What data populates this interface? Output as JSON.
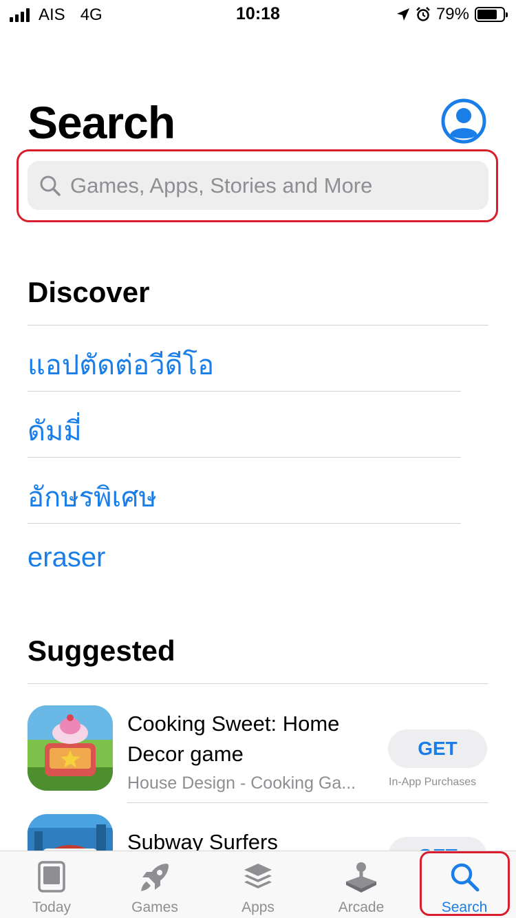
{
  "status_bar": {
    "carrier": "AIS",
    "network": "4G",
    "time": "10:18",
    "battery_percent": "79%",
    "battery_level": 0.79
  },
  "header": {
    "title": "Search",
    "account_icon": "person-circle-icon"
  },
  "search": {
    "placeholder": "Games, Apps, Stories and More",
    "value": ""
  },
  "discover": {
    "title": "Discover",
    "items": [
      "แอปตัดต่อวีดีโอ",
      "ดัมมี่",
      "อักษรพิเศษ",
      "eraser"
    ]
  },
  "suggested": {
    "title": "Suggested",
    "apps": [
      {
        "name_line1": "Cooking Sweet: Home",
        "name_line2": "Decor game",
        "subtitle": "House Design - Cooking Ga...",
        "button": "GET",
        "note": "In-App Purchases"
      },
      {
        "name_line1": "Subway Surfers",
        "button": "GET"
      }
    ]
  },
  "tab_bar": {
    "tabs": [
      {
        "label": "Today",
        "icon": "today-icon"
      },
      {
        "label": "Games",
        "icon": "rocket-icon"
      },
      {
        "label": "Apps",
        "icon": "stack-icon"
      },
      {
        "label": "Arcade",
        "icon": "joystick-icon"
      },
      {
        "label": "Search",
        "icon": "search-icon"
      }
    ],
    "active": "Search"
  },
  "colors": {
    "accent": "#1a7ee8",
    "highlight": "#d81e2c",
    "secondary_text": "#8e8e93"
  }
}
